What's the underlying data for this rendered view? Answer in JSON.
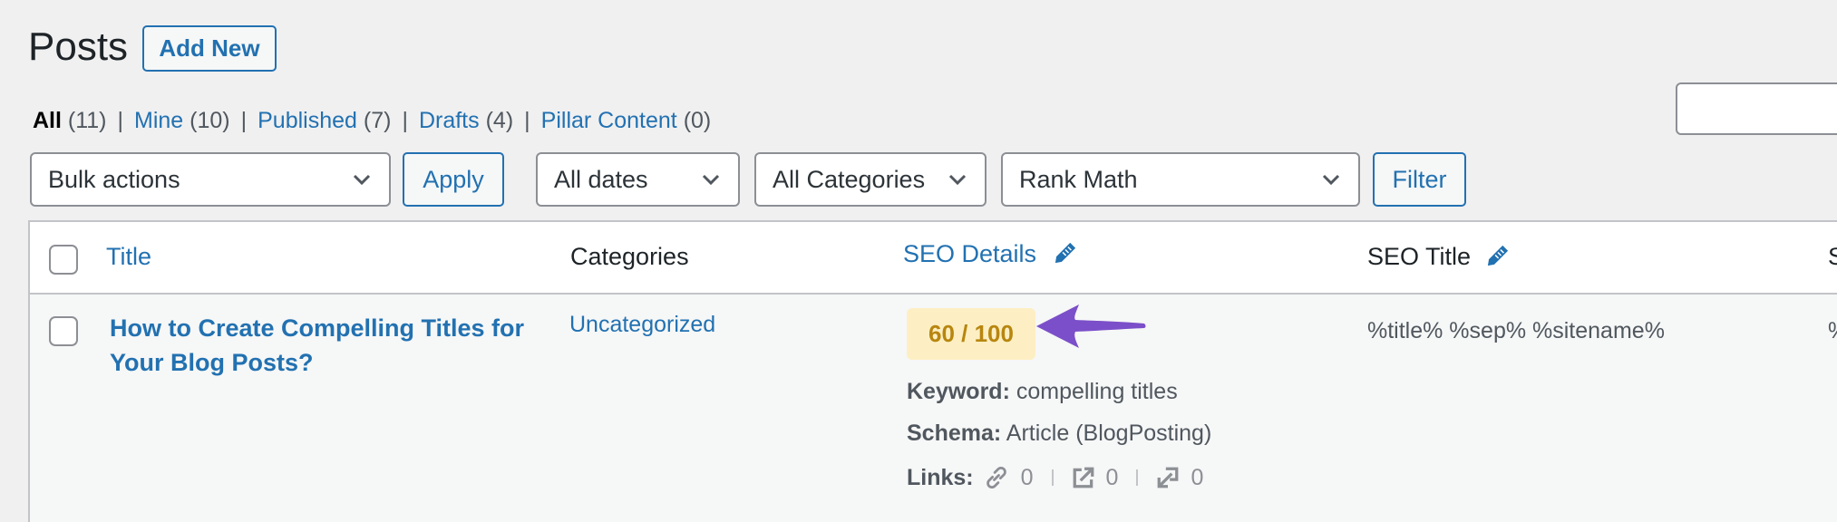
{
  "header": {
    "title": "Posts",
    "add_new_label": "Add New"
  },
  "views": [
    {
      "label": "All",
      "count": "(11)",
      "current": true
    },
    {
      "label": "Mine",
      "count": "(10)",
      "current": false
    },
    {
      "label": "Published",
      "count": "(7)",
      "current": false
    },
    {
      "label": "Drafts",
      "count": "(4)",
      "current": false
    },
    {
      "label": "Pillar Content",
      "count": "(0)",
      "current": false
    }
  ],
  "views_separator": "|",
  "search": {
    "value": "",
    "placeholder": ""
  },
  "toolbar": {
    "bulk_actions": "Bulk actions",
    "apply_label": "Apply",
    "dates": "All dates",
    "categories": "All Categories",
    "seo_filter": "Rank Math",
    "filter_label": "Filter"
  },
  "table": {
    "columns": {
      "title": "Title",
      "categories": "Categories",
      "seo_details": "SEO Details",
      "seo_title": "SEO Title",
      "next_partial": "S"
    },
    "rows": [
      {
        "title": "How to Create Compelling Titles for Your Blog Posts?",
        "category": "Uncategorized",
        "seo_score": "60 / 100",
        "keyword_label": "Keyword:",
        "keyword": "compelling titles",
        "schema_label": "Schema:",
        "schema": "Article (BlogPosting)",
        "links_label": "Links:",
        "internal_links": "0",
        "external_links": "0",
        "incoming_links": "0",
        "seo_title": "%title% %sep% %sitename%",
        "next_partial": "%"
      }
    ]
  },
  "colors": {
    "accent": "#2271b1",
    "score_badge_bg": "#fdefc3",
    "score_badge_text": "#b8860f",
    "annotation_arrow": "#7b4fc9"
  }
}
